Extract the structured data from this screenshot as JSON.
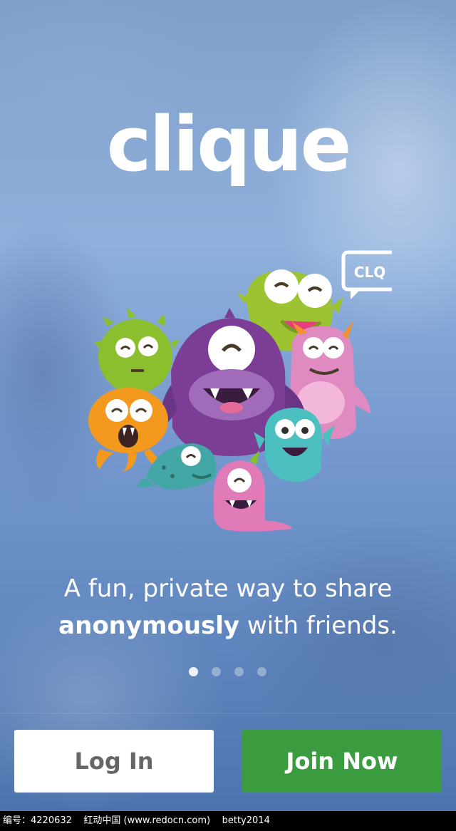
{
  "app": {
    "logo_text": "clique"
  },
  "hero": {
    "speech_bubble_text": "CLQ",
    "illustration": "monster-group-icon"
  },
  "tagline": {
    "line1": "A fun, private way to share",
    "line2_bold": "anonymously",
    "line2_rest": " with friends."
  },
  "pager": {
    "total_pages": 4,
    "current_page": 1
  },
  "buttons": {
    "login_label": "Log In",
    "join_label": "Join Now"
  },
  "footer": {
    "watermark_text": "编号：4220632    红动中国 (www.redocn.com)    betty2014"
  },
  "colors": {
    "join_button": "#3a9c3f",
    "login_button": "#ffffff",
    "login_text": "#666666"
  }
}
